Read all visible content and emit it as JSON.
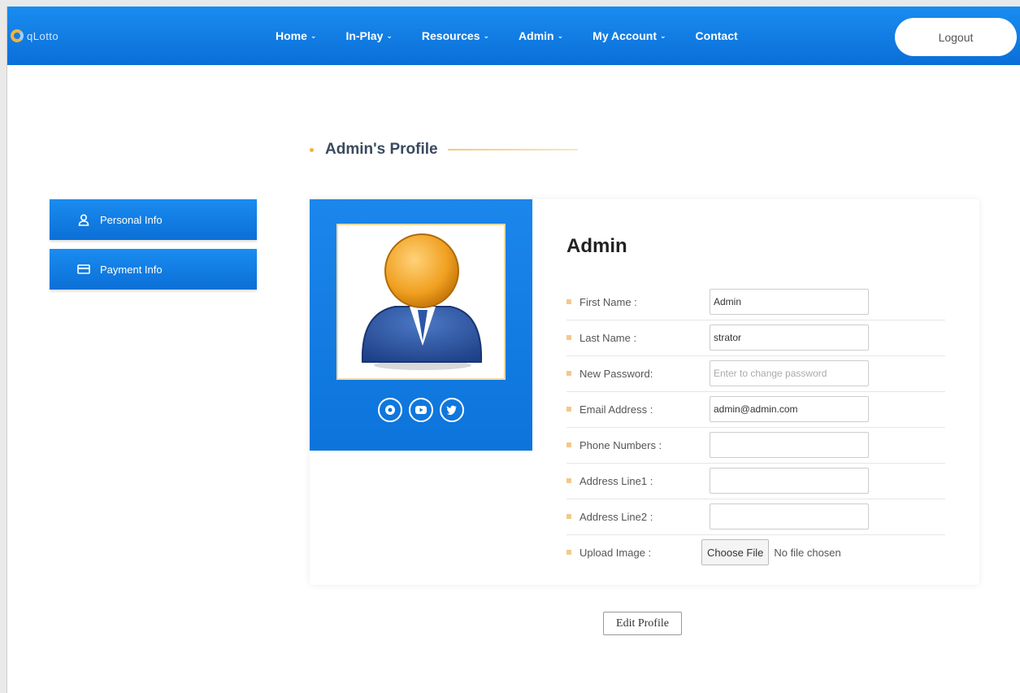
{
  "brand": {
    "logo_text": "qLotto",
    "logo_icon": "q-logo-icon"
  },
  "nav": {
    "items": [
      {
        "label": "Home",
        "has_dropdown": true
      },
      {
        "label": "In-Play",
        "has_dropdown": true
      },
      {
        "label": "Resources",
        "has_dropdown": true
      },
      {
        "label": "Admin",
        "has_dropdown": true
      },
      {
        "label": "My Account",
        "has_dropdown": true
      },
      {
        "label": "Contact",
        "has_dropdown": false
      }
    ],
    "logout_label": "Logout"
  },
  "page": {
    "heading": "Admin's Profile"
  },
  "sidebar": {
    "items": [
      {
        "label": "Personal Info",
        "icon": "user-icon"
      },
      {
        "label": "Payment Info",
        "icon": "credit-card-icon"
      }
    ]
  },
  "profile": {
    "display_name": "Admin",
    "social_icons": [
      "instagram-icon",
      "youtube-icon",
      "twitter-icon"
    ],
    "fields": {
      "first_name": {
        "label": "First Name :",
        "value": "Admin",
        "placeholder": ""
      },
      "last_name": {
        "label": "Last Name :",
        "value": "strator",
        "placeholder": ""
      },
      "new_password": {
        "label": "New Password:",
        "value": "",
        "placeholder": "Enter to change password"
      },
      "email": {
        "label": "Email Address :",
        "value": "admin@admin.com",
        "placeholder": ""
      },
      "phone": {
        "label": "Phone Numbers :",
        "value": "",
        "placeholder": ""
      },
      "address1": {
        "label": "Address Line1 :",
        "value": "",
        "placeholder": ""
      },
      "address2": {
        "label": "Address Line2 :",
        "value": "",
        "placeholder": ""
      },
      "upload": {
        "label": "Upload Image :",
        "button_label": "Choose File",
        "status": "No file chosen"
      }
    },
    "edit_button_label": "Edit Profile"
  },
  "colors": {
    "primary_blue": "#0b74dc",
    "accent_orange": "#f4b23b",
    "heading_text": "#3a4a5e"
  }
}
